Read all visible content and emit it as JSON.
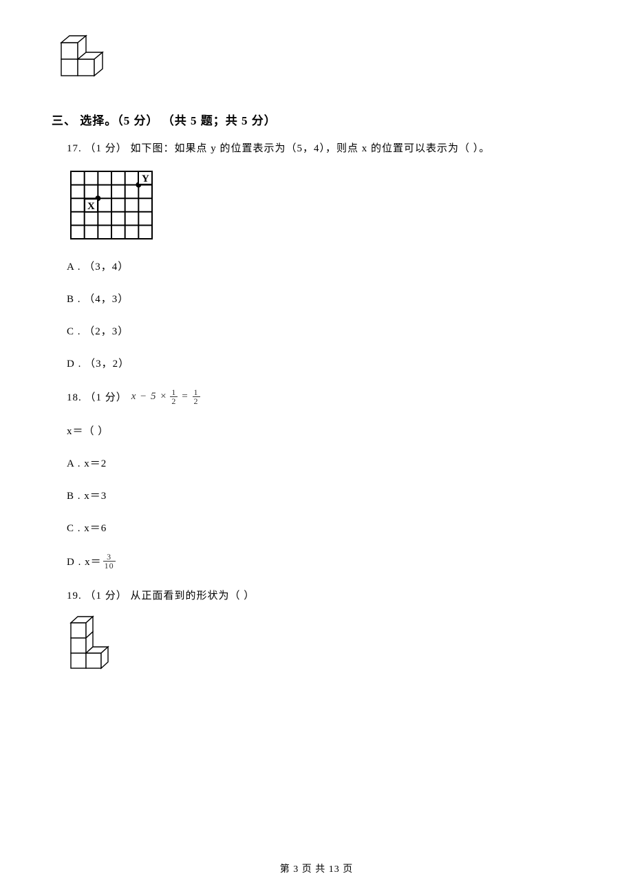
{
  "section": {
    "heading": "三、 选择。（5 分） （共 5 题；共 5 分）"
  },
  "q17": {
    "stem_prefix": "17.  （1 分）  如下图：如果点 y 的位置表示为（5，4），则点 x 的位置可以表示为（     ）。",
    "optA": "A .  （3，4）",
    "optB": "B .  （4，3）",
    "optC": "C .  （2，3）",
    "optD": "D .  （3，2）"
  },
  "q18": {
    "prefix": "18.  （1 分） ",
    "eq_left": "x − 5 ×",
    "eq_eq": "=",
    "f1_num": "1",
    "f1_den": "2",
    "f2_num": "1",
    "f2_den": "2",
    "xline": "x＝（     ）",
    "optA": "A .  x＝2",
    "optB": "B .  x＝3",
    "optC": "C .  x＝6",
    "optD_prefix": "D .  x＝",
    "fD_num": "3",
    "fD_den": "10"
  },
  "q19": {
    "stem": "19.  （1 分）  从正面看到的形状为（     ）"
  },
  "footer": {
    "text": "第 3 页 共 13 页"
  }
}
